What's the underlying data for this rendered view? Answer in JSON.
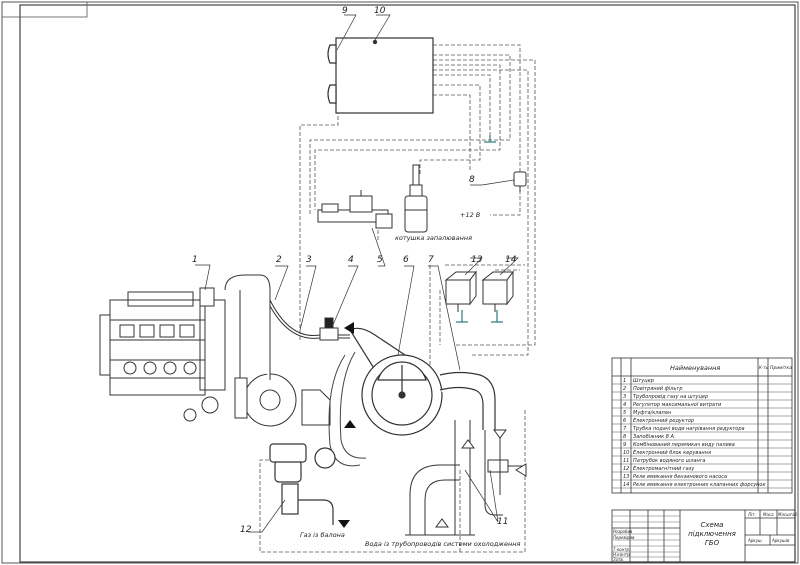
{
  "callouts": [
    "1",
    "2",
    "3",
    "4",
    "5",
    "6",
    "7",
    "8",
    "9",
    "10",
    "11",
    "12",
    "13",
    "14"
  ],
  "labels": {
    "ignition_coil": "котушка запалювання",
    "voltage": "+12 В",
    "gas_from_tank": "Газ із балона",
    "water_from_cooling": "Вода із трубопроводів системи охолодження"
  },
  "bom": {
    "header_name": "Найменування",
    "header_qty": "К-ть",
    "header_note": "Примітка",
    "rows": [
      {
        "pos": "1",
        "name": "Штуцер"
      },
      {
        "pos": "2",
        "name": "Повітряний фільтр"
      },
      {
        "pos": "3",
        "name": "Трубопровід газу на штуцер"
      },
      {
        "pos": "4",
        "name": "Регулятор максимальної витрати"
      },
      {
        "pos": "5",
        "name": "Муфта/клапан"
      },
      {
        "pos": "6",
        "name": "Електронний редуктор"
      },
      {
        "pos": "7",
        "name": "Трубка подачі води нагрівання редуктора"
      },
      {
        "pos": "8",
        "name": "Запобіжник 8 А"
      },
      {
        "pos": "9",
        "name": "Комбінований перемикач виду палива"
      },
      {
        "pos": "10",
        "name": "Електронний блок керування"
      },
      {
        "pos": "11",
        "name": "Патрубок водяного шланга"
      },
      {
        "pos": "12",
        "name": "Електромагнітний газу"
      },
      {
        "pos": "13",
        "name": "Реле вмикання бензинового насоса"
      },
      {
        "pos": "14",
        "name": "Реле вмикання електронних клапанних форсунок"
      }
    ]
  },
  "title_block": {
    "title_line1": "Схема",
    "title_line2": "підключення",
    "title_line3": "ГБО",
    "hdr_lit": "Літ.",
    "hdr_mass": "Маса",
    "hdr_scale": "Масштаб",
    "sheet_label": "Аркуш",
    "sheets_label": "Аркушів",
    "roles": [
      "Розробив",
      "Перевірив",
      "Т.контр.",
      "Н.контр.",
      "Затв."
    ]
  }
}
